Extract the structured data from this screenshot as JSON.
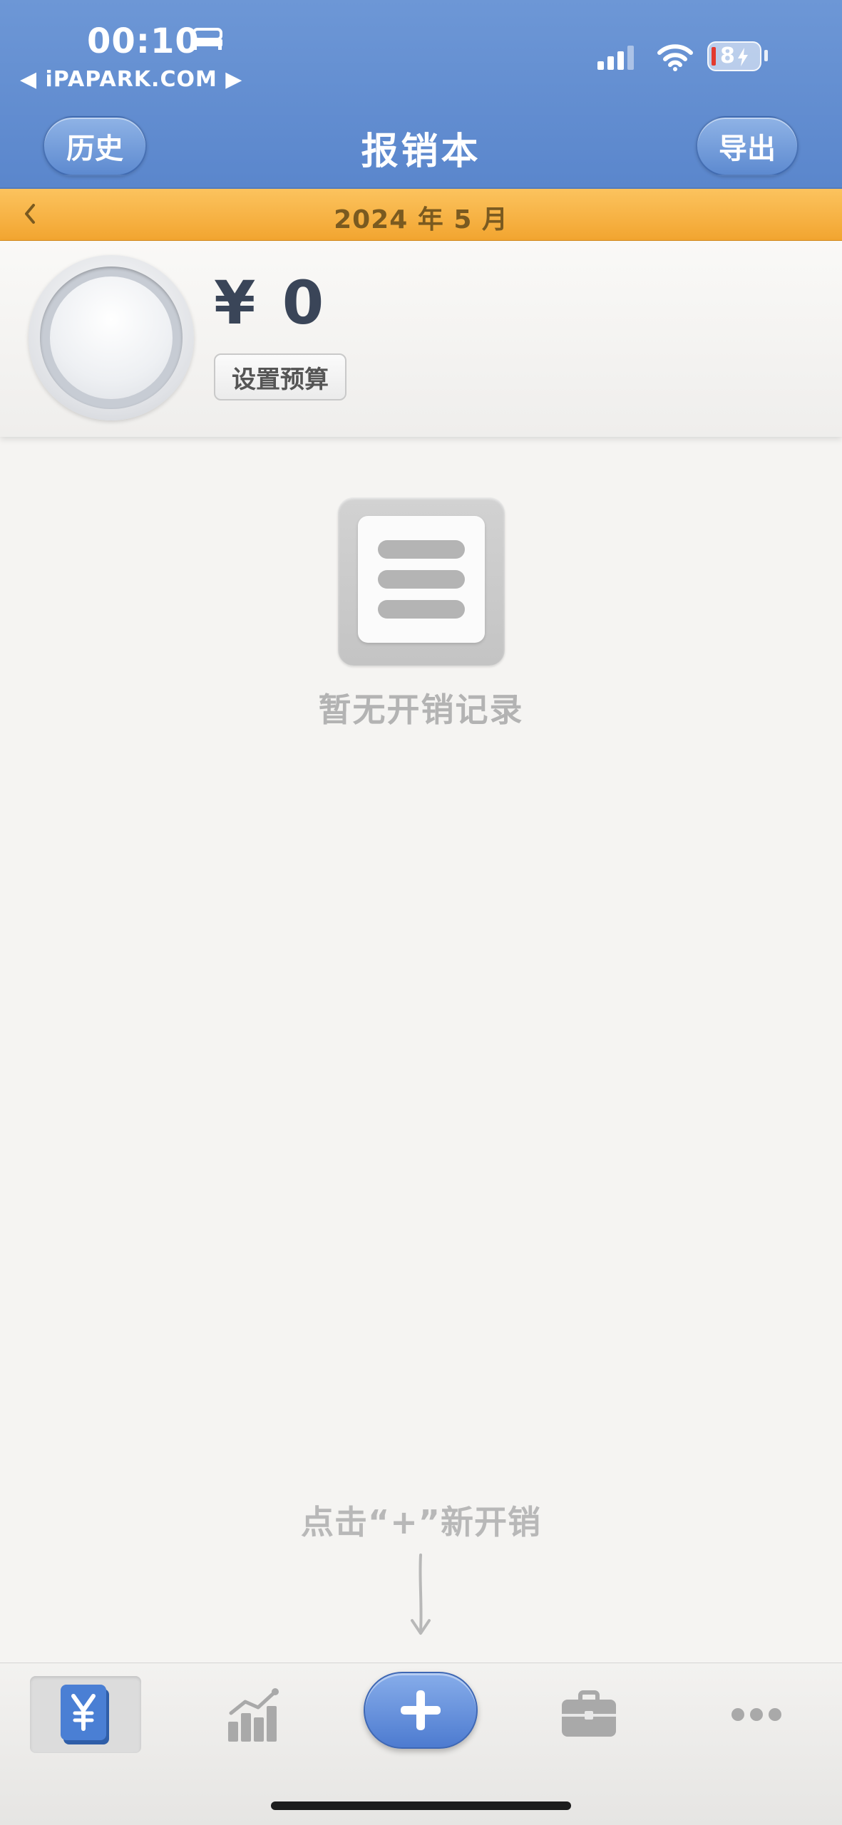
{
  "status_bar": {
    "time": "00:10",
    "carrier": "◀ iPAPARK.COM ▶",
    "battery": "8"
  },
  "nav": {
    "left_button": "历史",
    "title": "报销本",
    "right_button": "导出"
  },
  "month_bar": {
    "label": "2024 年 5 月"
  },
  "summary": {
    "amount": "¥ 0",
    "budget_button": "设置预算"
  },
  "empty_state": {
    "message": "暂无开销记录"
  },
  "hint": {
    "text": "点击“+”新开销"
  },
  "tabbar": {
    "tabs": [
      {
        "icon": "yen-ledger-icon",
        "selected": true
      },
      {
        "icon": "chart-icon",
        "selected": false
      },
      {
        "icon": "plus-icon",
        "selected": false
      },
      {
        "icon": "briefcase-icon",
        "selected": false
      },
      {
        "icon": "more-icon",
        "selected": false
      }
    ]
  },
  "colors": {
    "nav_blue": "#5f8ad0",
    "month_orange": "#f8b444",
    "accent_blue": "#4d7bd0"
  }
}
